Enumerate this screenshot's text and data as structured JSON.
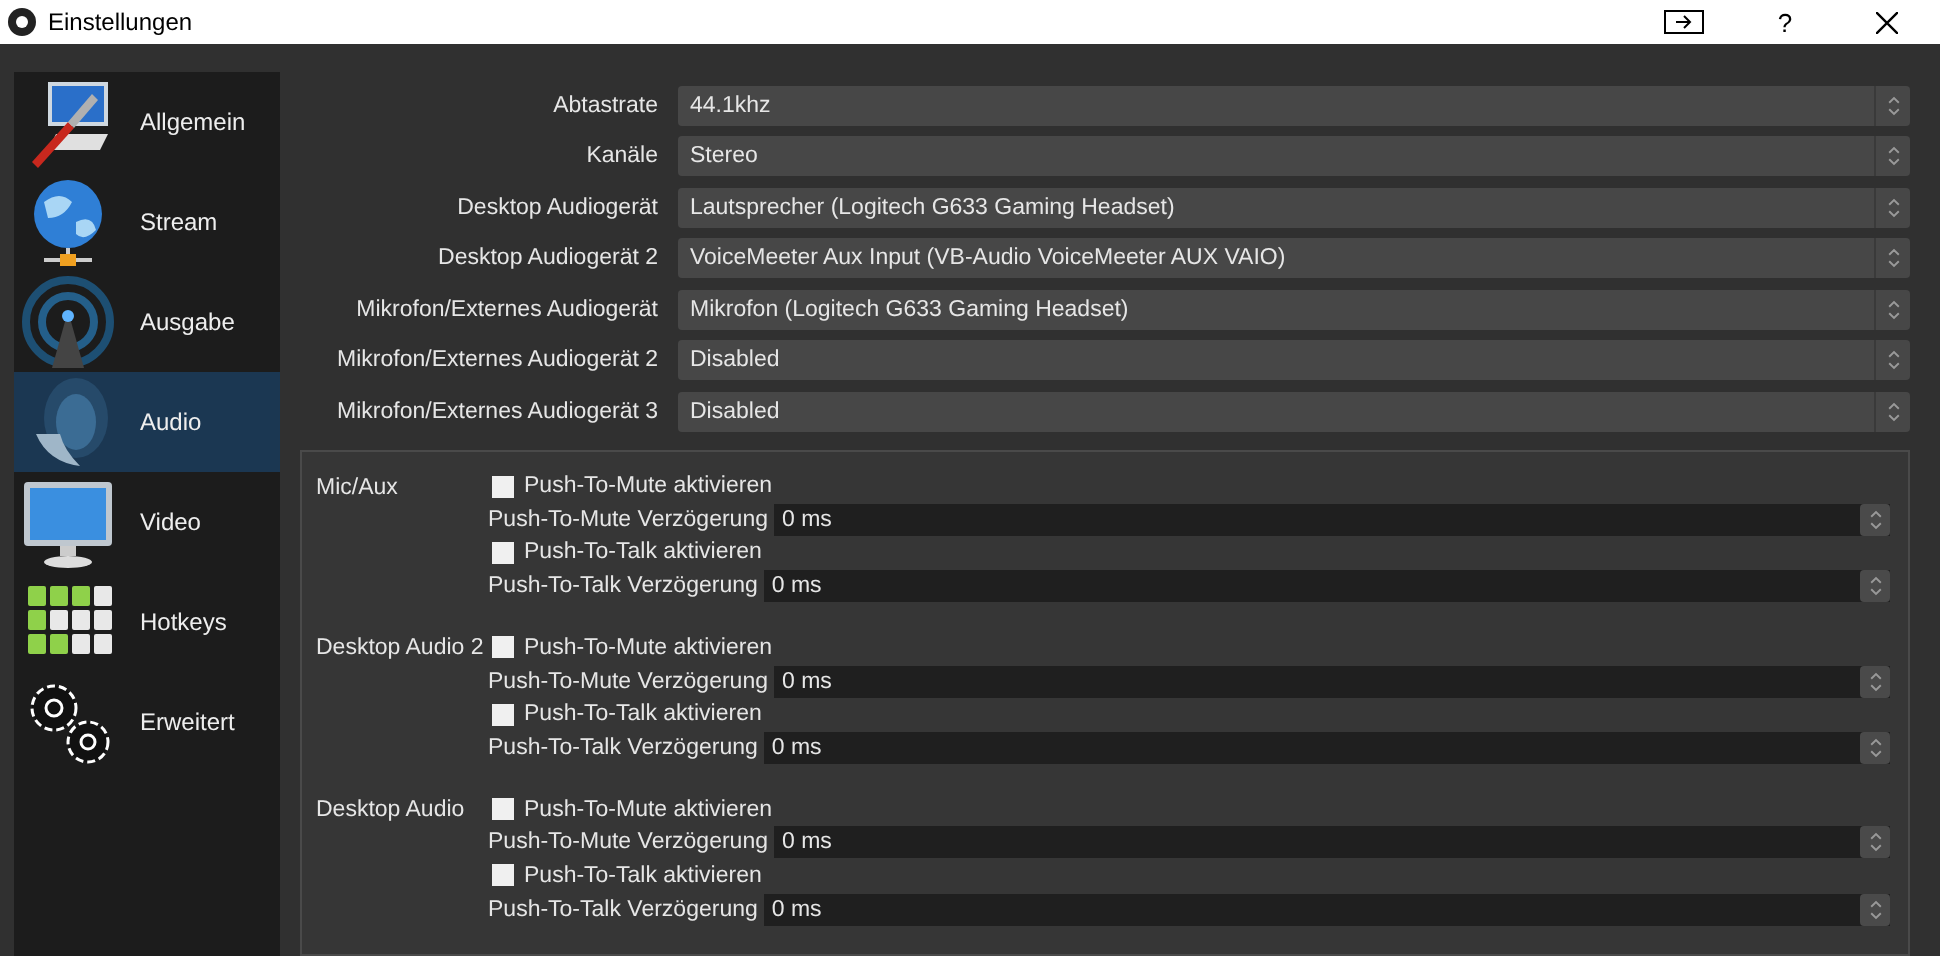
{
  "window": {
    "title": "Einstellungen",
    "help": "?"
  },
  "sidebar": {
    "items": [
      {
        "kind": "general",
        "label": "Allgemein",
        "selected": false
      },
      {
        "kind": "stream",
        "label": "Stream",
        "selected": false
      },
      {
        "kind": "output",
        "label": "Ausgabe",
        "selected": false
      },
      {
        "kind": "audio",
        "label": "Audio",
        "selected": true
      },
      {
        "kind": "video",
        "label": "Video",
        "selected": false
      },
      {
        "kind": "hotkeys",
        "label": "Hotkeys",
        "selected": false
      },
      {
        "kind": "advanced",
        "label": "Erweitert",
        "selected": false
      }
    ]
  },
  "audio_settings": [
    {
      "label": "Abtastrate",
      "value": "44.1khz"
    },
    {
      "label": "Kanäle",
      "value": "Stereo"
    },
    {
      "label": "Desktop Audiogerät",
      "value": "Lautsprecher (Logitech G633 Gaming Headset)"
    },
    {
      "label": "Desktop Audiogerät 2",
      "value": "VoiceMeeter Aux Input (VB-Audio VoiceMeeter AUX VAIO)"
    },
    {
      "label": "Mikrofon/Externes Audiogerät",
      "value": "Mikrofon (Logitech G633 Gaming Headset)"
    },
    {
      "label": "Mikrofon/Externes Audiogerät 2",
      "value": "Disabled"
    },
    {
      "label": "Mikrofon/Externes Audiogerät 3",
      "value": "Disabled"
    }
  ],
  "sections": [
    {
      "label": "Mic/Aux",
      "rows": [
        {
          "kind": "checkbox",
          "label": "Push-To-Mute aktivieren",
          "checked": false
        },
        {
          "kind": "spin",
          "label": "Push-To-Mute Verzögerung",
          "value": "0 ms"
        },
        {
          "kind": "checkbox",
          "label": "Push-To-Talk aktivieren",
          "checked": false
        },
        {
          "kind": "spin",
          "label": "Push-To-Talk Verzögerung",
          "value": "0 ms"
        }
      ]
    },
    {
      "label": "Desktop Audio 2",
      "rows": [
        {
          "kind": "checkbox",
          "label": "Push-To-Mute aktivieren",
          "checked": false
        },
        {
          "kind": "spin",
          "label": "Push-To-Mute Verzögerung",
          "value": "0 ms"
        },
        {
          "kind": "checkbox",
          "label": "Push-To-Talk aktivieren",
          "checked": false
        },
        {
          "kind": "spin",
          "label": "Push-To-Talk Verzögerung",
          "value": "0 ms"
        }
      ]
    },
    {
      "label": "Desktop Audio",
      "rows": [
        {
          "kind": "checkbox",
          "label": "Push-To-Mute aktivieren",
          "checked": false
        },
        {
          "kind": "spin",
          "label": "Push-To-Mute Verzögerung",
          "value": "0 ms"
        },
        {
          "kind": "checkbox",
          "label": "Push-To-Talk aktivieren",
          "checked": false
        },
        {
          "kind": "spin",
          "label": "Push-To-Talk Verzögerung",
          "value": "0 ms"
        }
      ]
    }
  ]
}
